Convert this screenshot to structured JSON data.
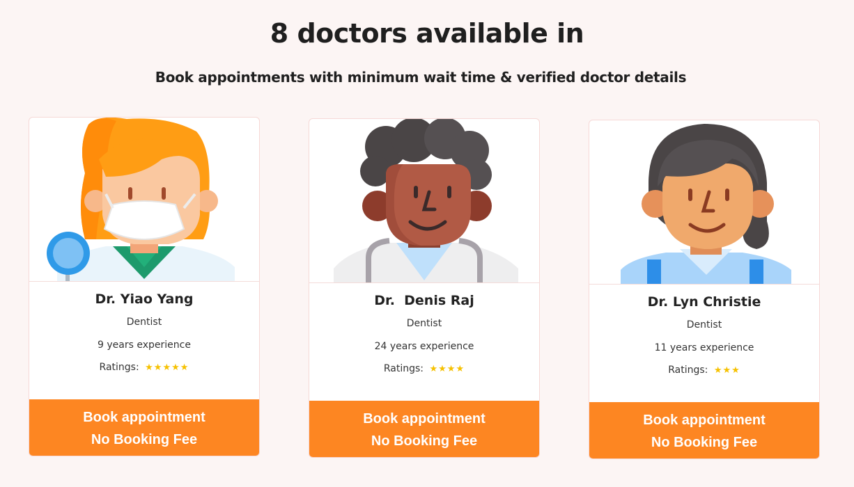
{
  "page": {
    "title": "8 doctors available in",
    "subtitle": "Book appointments with minimum wait time & verified doctor details"
  },
  "doctors": [
    {
      "name": "Dr. Yiao Yang",
      "specialty": "Dentist",
      "experience": "9 years experience",
      "ratings_label": "Ratings:",
      "stars": "★★★★★",
      "rating": 5,
      "book_label": "Book appointment",
      "fee_label": "No Booking Fee",
      "avatar_icon": "female-doctor-mask-icon"
    },
    {
      "name": "Dr.  Denis Raj",
      "specialty": "Dentist",
      "experience": "24 years experience",
      "ratings_label": "Ratings:",
      "stars": "★★★★",
      "rating": 4,
      "book_label": "Book appointment",
      "fee_label": "No Booking Fee",
      "avatar_icon": "male-doctor-stethoscope-icon"
    },
    {
      "name": "Dr. Lyn Christie",
      "specialty": "Dentist",
      "experience": "11 years experience",
      "ratings_label": "Ratings:",
      "stars": "★★★",
      "rating": 3,
      "book_label": "Book appointment",
      "fee_label": "No Booking Fee",
      "avatar_icon": "female-doctor-icon"
    }
  ],
  "colors": {
    "background": "#fcf5f4",
    "accent": "#fd8622",
    "star": "#f6c100",
    "card_border": "#f6d8d6"
  }
}
